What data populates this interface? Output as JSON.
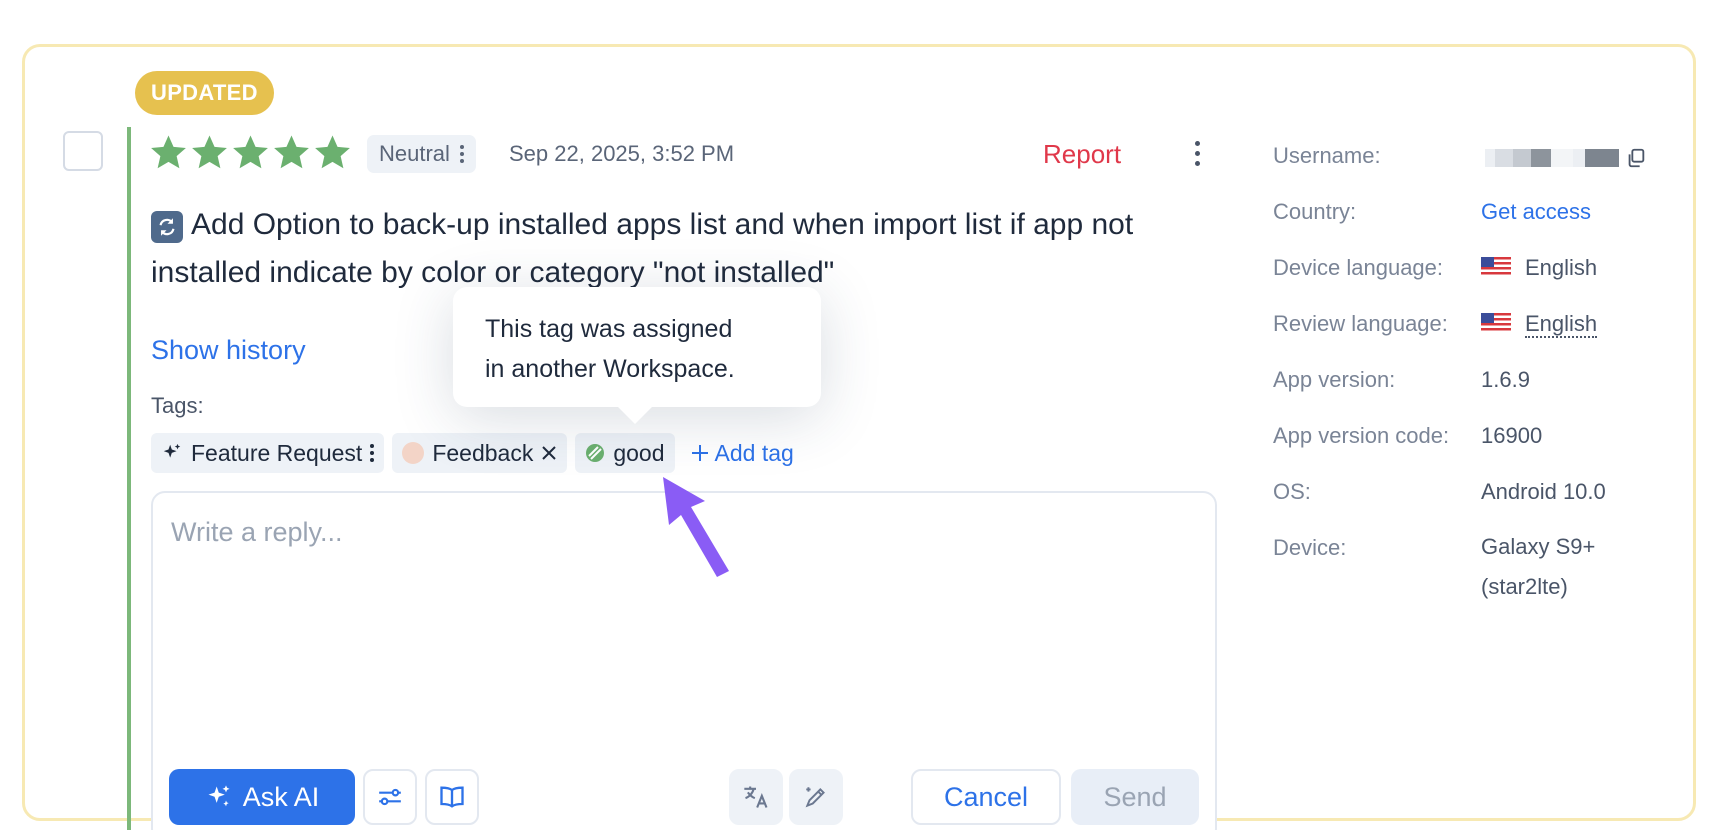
{
  "badge": "UPDATED",
  "review": {
    "rating": 5,
    "sentiment": "Neutral",
    "date": "Sep 22, 2025, 3:52 PM",
    "report_label": "Report",
    "text": "Add Option to back-up installed apps list and when import list if app not installed indicate by color or category \"not installed\"",
    "show_history": "Show history",
    "tags_label": "Tags:",
    "tags": [
      {
        "label": "Feature Request",
        "icon": "sparkle-icon"
      },
      {
        "label": "Feedback",
        "icon": "peach-dot"
      },
      {
        "label": "good",
        "icon": "striped-dot-icon"
      }
    ],
    "add_tag": "Add tag",
    "tooltip": {
      "line1": "This tag was assigned",
      "line2": "in another Workspace."
    }
  },
  "reply": {
    "placeholder": "Write a reply...",
    "ask_ai": "Ask AI",
    "cancel": "Cancel",
    "send": "Send"
  },
  "meta": {
    "username_label": "Username:",
    "country_label": "Country:",
    "country_value": "Get access",
    "device_language_label": "Device language:",
    "device_language_value": "English",
    "review_language_label": "Review language:",
    "review_language_value": "English",
    "app_version_label": "App version:",
    "app_version_value": "1.6.9",
    "app_version_code_label": "App version code:",
    "app_version_code_value": "16900",
    "os_label": "OS:",
    "os_value": "Android 10.0",
    "device_label": "Device:",
    "device_value_line1": "Galaxy S9+",
    "device_value_line2": "(star2lte)"
  },
  "colors": {
    "star": "#6bb06f",
    "accent": "#2d72e8",
    "report": "#e0384a",
    "badge": "#e6c14f",
    "card_border": "#f7e9b3",
    "arrow": "#8a5cf5"
  }
}
